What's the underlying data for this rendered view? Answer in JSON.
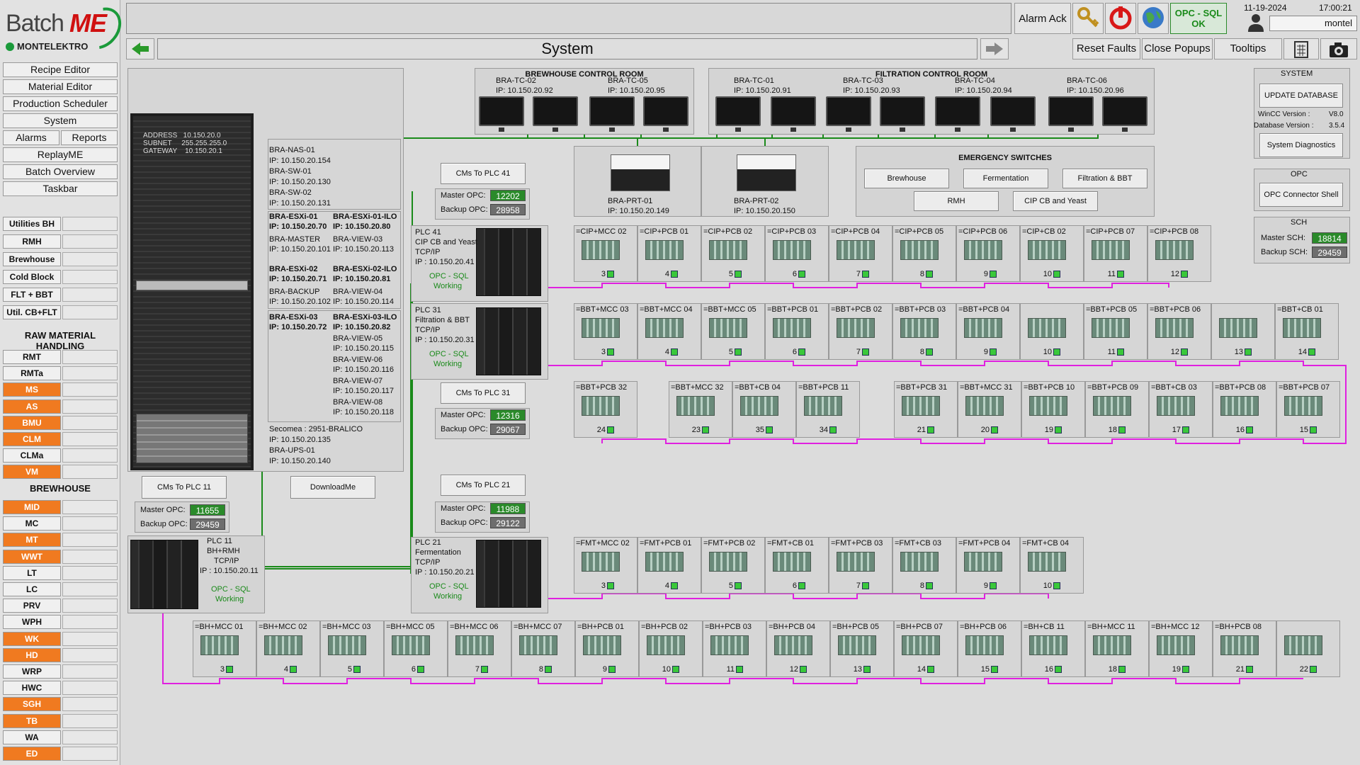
{
  "app": {
    "logo_batch": "Batch",
    "logo_me": "ME",
    "logo_company": "MONTELEKTRO"
  },
  "nav": {
    "items": [
      "Recipe Editor",
      "Material Editor",
      "Production Scheduler",
      "System"
    ],
    "alarms": "Alarms",
    "reports": "Reports",
    "items2": [
      "ReplayME",
      "Batch Overview",
      "Taskbar"
    ]
  },
  "units": {
    "list1": [
      "Utilities BH",
      "RMH",
      "Brewhouse",
      "Cold Block",
      "FLT + BBT",
      "Util. CB+FLT"
    ],
    "raw_header": "RAW MATERIAL HANDLING",
    "raw": [
      {
        "l": "RMT",
        "o": false
      },
      {
        "l": "RMTa",
        "o": false
      },
      {
        "l": "MS",
        "o": true
      },
      {
        "l": "AS",
        "o": true
      },
      {
        "l": "BMU",
        "o": true
      },
      {
        "l": "CLM",
        "o": true
      },
      {
        "l": "CLMa",
        "o": false
      },
      {
        "l": "VM",
        "o": true
      }
    ],
    "bh_header": "BREWHOUSE",
    "bh": [
      {
        "l": "MID",
        "o": true
      },
      {
        "l": "MC",
        "o": false
      },
      {
        "l": "MT",
        "o": true
      },
      {
        "l": "WWT",
        "o": true
      },
      {
        "l": "LT",
        "o": false
      },
      {
        "l": "LC",
        "o": false
      },
      {
        "l": "PRV",
        "o": false
      },
      {
        "l": "WPH",
        "o": false
      },
      {
        "l": "WK",
        "o": true
      },
      {
        "l": "HD",
        "o": true
      },
      {
        "l": "WRP",
        "o": false
      },
      {
        "l": "HWC",
        "o": false
      },
      {
        "l": "SGH",
        "o": true
      },
      {
        "l": "TB",
        "o": true
      },
      {
        "l": "WA",
        "o": false
      },
      {
        "l": "ED",
        "o": true
      }
    ]
  },
  "top": {
    "alarm_ack": "Alarm Ack",
    "opc_status_1": "OPC - SQL",
    "opc_status_2": "OK",
    "date": "11-19-2024",
    "time": "17:00:21",
    "user": "montel",
    "page_title": "System",
    "reset_faults": "Reset Faults",
    "close_popups": "Close Popups",
    "tooltips": "Tooltips"
  },
  "rack": {
    "address": "ADDRESS   10.150.20.0",
    "subnet": "SUBNET     255.255.255.0",
    "gateway": "GATEWAY    10.150.20.1"
  },
  "servers": {
    "nas": [
      "BRA-NAS-01",
      "IP: 10.150.20.154",
      "BRA-SW-01",
      "IP: 10.150.20.130",
      "BRA-SW-02",
      "IP: 10.150.20.131"
    ],
    "esxi1": [
      "BRA-ESXi-01",
      "IP: 10.150.20.70",
      "BRA-ESXi-01-ILO",
      "IP: 10.150.20.80",
      "BRA-MASTER",
      "IP: 10.150.20.101",
      "BRA-VIEW-03",
      "IP: 10.150.20.113"
    ],
    "esxi2": [
      "BRA-ESXi-02",
      "IP: 10.150.20.71",
      "BRA-ESXi-02-ILO",
      "IP: 10.150.20.81",
      "BRA-BACKUP",
      "IP: 10.150.20.102",
      "BRA-VIEW-04",
      "IP: 10.150.20.114"
    ],
    "esxi3": [
      "BRA-ESXi-03",
      "IP: 10.150.20.72",
      "BRA-ESXi-03-ILO",
      "IP: 10.150.20.82",
      "BRA-VIEW-05",
      "IP: 10.150.20.115",
      "BRA-VIEW-06",
      "IP: 10.150.20.116",
      "BRA-VIEW-07",
      "IP: 10.150.20.117",
      "BRA-VIEW-08",
      "IP: 10.150.20.118"
    ],
    "secomea": [
      "Secomea : 2951-BRALICO",
      "IP: 10.150.20.135",
      "BRA-UPS-01",
      "IP: 10.150.20.140"
    ],
    "download": "DownloadMe"
  },
  "brew_room": {
    "title": "BREWHOUSE CONTROL ROOM",
    "pcs": [
      [
        "BRA-TC-02",
        "IP: 10.150.20.92"
      ],
      [
        "BRA-TC-05",
        "IP: 10.150.20.95"
      ]
    ]
  },
  "filt_room": {
    "title": "FILTRATION CONTROL ROOM",
    "pcs": [
      [
        "BRA-TC-01",
        "IP: 10.150.20.91"
      ],
      [
        "BRA-TC-03",
        "IP: 10.150.20.93"
      ],
      [
        "BRA-TC-04",
        "IP: 10.150.20.94"
      ],
      [
        "BRA-TC-06",
        "IP: 10.150.20.96"
      ]
    ]
  },
  "printers": [
    [
      "BRA-PRT-01",
      "IP: 10.150.20.149"
    ],
    [
      "BRA-PRT-02",
      "IP: 10.150.20.150"
    ]
  ],
  "emergency": {
    "title": "EMERGENCY SWITCHES",
    "buttons": [
      "Brewhouse",
      "Fermentation",
      "Filtration & BBT",
      "RMH",
      "CIP CB and Yeast"
    ]
  },
  "opc_labels": {
    "master": "Master OPC:",
    "backup": "Backup OPC:"
  },
  "plc41": {
    "cms": "CMs To PLC 41",
    "master": "12202",
    "backup": "28958",
    "name": "PLC 41",
    "desc": "CIP CB and Yeast",
    "proto": "TCP/IP",
    "ip": "IP : 10.150.20.41",
    "opc": "OPC - SQL",
    "state": "Working"
  },
  "plc31": {
    "cms": "CMs To PLC 31",
    "master": "12316",
    "backup": "29067",
    "name": "PLC 31",
    "desc": "Filtration & BBT",
    "proto": "TCP/IP",
    "ip": "IP : 10.150.20.31",
    "opc": "OPC - SQL",
    "state": "Working"
  },
  "plc21": {
    "cms": "CMs To PLC 21",
    "master": "11988",
    "backup": "29122",
    "name": "PLC 21",
    "desc": "Fermentation",
    "proto": "TCP/IP",
    "ip": "IP : 10.150.20.21",
    "opc": "OPC - SQL",
    "state": "Working"
  },
  "plc11": {
    "cms": "CMs To PLC 11",
    "master": "11655",
    "backup": "29459",
    "name": "PLC 11",
    "desc": "BH+RMH",
    "proto": "TCP/IP",
    "ip": "IP : 10.150.20.11",
    "opc": "OPC - SQL",
    "state": "Working"
  },
  "right": {
    "system_title": "SYSTEM",
    "update_db": "UPDATE DATABASE",
    "wincc_label": "WinCC Version :",
    "wincc_val": "V8.0",
    "db_label": "Database Version :",
    "db_val": "3.5.4",
    "diag": "System Diagnostics",
    "opc_title": "OPC",
    "opc_shell": "OPC Connector Shell",
    "sch_title": "SCH",
    "master_sch": "Master SCH:",
    "master_sch_val": "18814",
    "backup_sch": "Backup SCH:",
    "backup_sch_val": "29459"
  },
  "row1": [
    [
      "=CIP+MCC 02",
      "3"
    ],
    [
      "=CIP+PCB 01",
      "4"
    ],
    [
      "=CIP+PCB 02",
      "5"
    ],
    [
      "=CIP+PCB 03",
      "6"
    ],
    [
      "=CIP+PCB 04",
      "7"
    ],
    [
      "=CIP+PCB 05",
      "8"
    ],
    [
      "=CIP+PCB 06",
      "9"
    ],
    [
      "=CIP+CB 02",
      "10"
    ],
    [
      "=CIP+PCB 07",
      "11"
    ],
    [
      "=CIP+PCB 08",
      "12"
    ]
  ],
  "row2": [
    [
      "=BBT+MCC 03",
      "3"
    ],
    [
      "=BBT+MCC 04",
      "4"
    ],
    [
      "=BBT+MCC 05",
      "5"
    ],
    [
      "=BBT+PCB 01",
      "6"
    ],
    [
      "=BBT+PCB 02",
      "7"
    ],
    [
      "=BBT+PCB 03",
      "8"
    ],
    [
      "=BBT+PCB 04",
      "9"
    ],
    [
      "",
      "10"
    ],
    [
      "=BBT+PCB 05",
      "11"
    ],
    [
      "=BBT+PCB 06",
      "12"
    ],
    [
      "",
      "13"
    ],
    [
      "=BBT+CB 01",
      "14"
    ]
  ],
  "row3": [
    [
      "=BBT+PCB 32",
      "24"
    ],
    [
      "=BBT+MCC 32",
      "23"
    ],
    [
      "=BBT+CB 04",
      "35"
    ],
    [
      "=BBT+PCB 11",
      "34"
    ],
    [
      "=BBT+PCB 31",
      "21"
    ],
    [
      "=BBT+MCC 31",
      "20"
    ],
    [
      "=BBT+PCB 10",
      "19"
    ],
    [
      "=BBT+PCB 09",
      "18"
    ],
    [
      "=BBT+CB 03",
      "17"
    ],
    [
      "=BBT+PCB 08",
      "16"
    ],
    [
      "=BBT+PCB 07",
      "15"
    ]
  ],
  "row4": [
    [
      "=FMT+MCC 02",
      "3"
    ],
    [
      "=FMT+PCB 01",
      "4"
    ],
    [
      "=FMT+PCB 02",
      "5"
    ],
    [
      "=FMT+CB 01",
      "6"
    ],
    [
      "=FMT+PCB 03",
      "7"
    ],
    [
      "=FMT+CB 03",
      "8"
    ],
    [
      "=FMT+PCB 04",
      "9"
    ],
    [
      "=FMT+CB 04",
      "10"
    ]
  ],
  "row5": [
    [
      "=BH+MCC 01",
      "3"
    ],
    [
      "=BH+MCC 02",
      "4"
    ],
    [
      "=BH+MCC 03",
      "5"
    ],
    [
      "=BH+MCC 05",
      "6"
    ],
    [
      "=BH+MCC 06",
      "7"
    ],
    [
      "=BH+MCC 07",
      "8"
    ],
    [
      "=BH+PCB 01",
      "9"
    ],
    [
      "=BH+PCB 02",
      "10"
    ],
    [
      "=BH+PCB 03",
      "11"
    ],
    [
      "=BH+PCB 04",
      "12"
    ],
    [
      "=BH+PCB 05",
      "13"
    ],
    [
      "=BH+PCB 07",
      "14"
    ],
    [
      "=BH+PCB 06",
      "15"
    ],
    [
      "=BH+CB 11",
      "16"
    ],
    [
      "=BH+MCC 11",
      "18"
    ],
    [
      "=BH+MCC 12",
      "19"
    ],
    [
      "=BH+PCB 08",
      "21"
    ],
    [
      "",
      "22"
    ]
  ],
  "colors": {
    "profinet": "#e020e0",
    "ethernet": "#1a8a1a",
    "accent": "#f07a20"
  }
}
